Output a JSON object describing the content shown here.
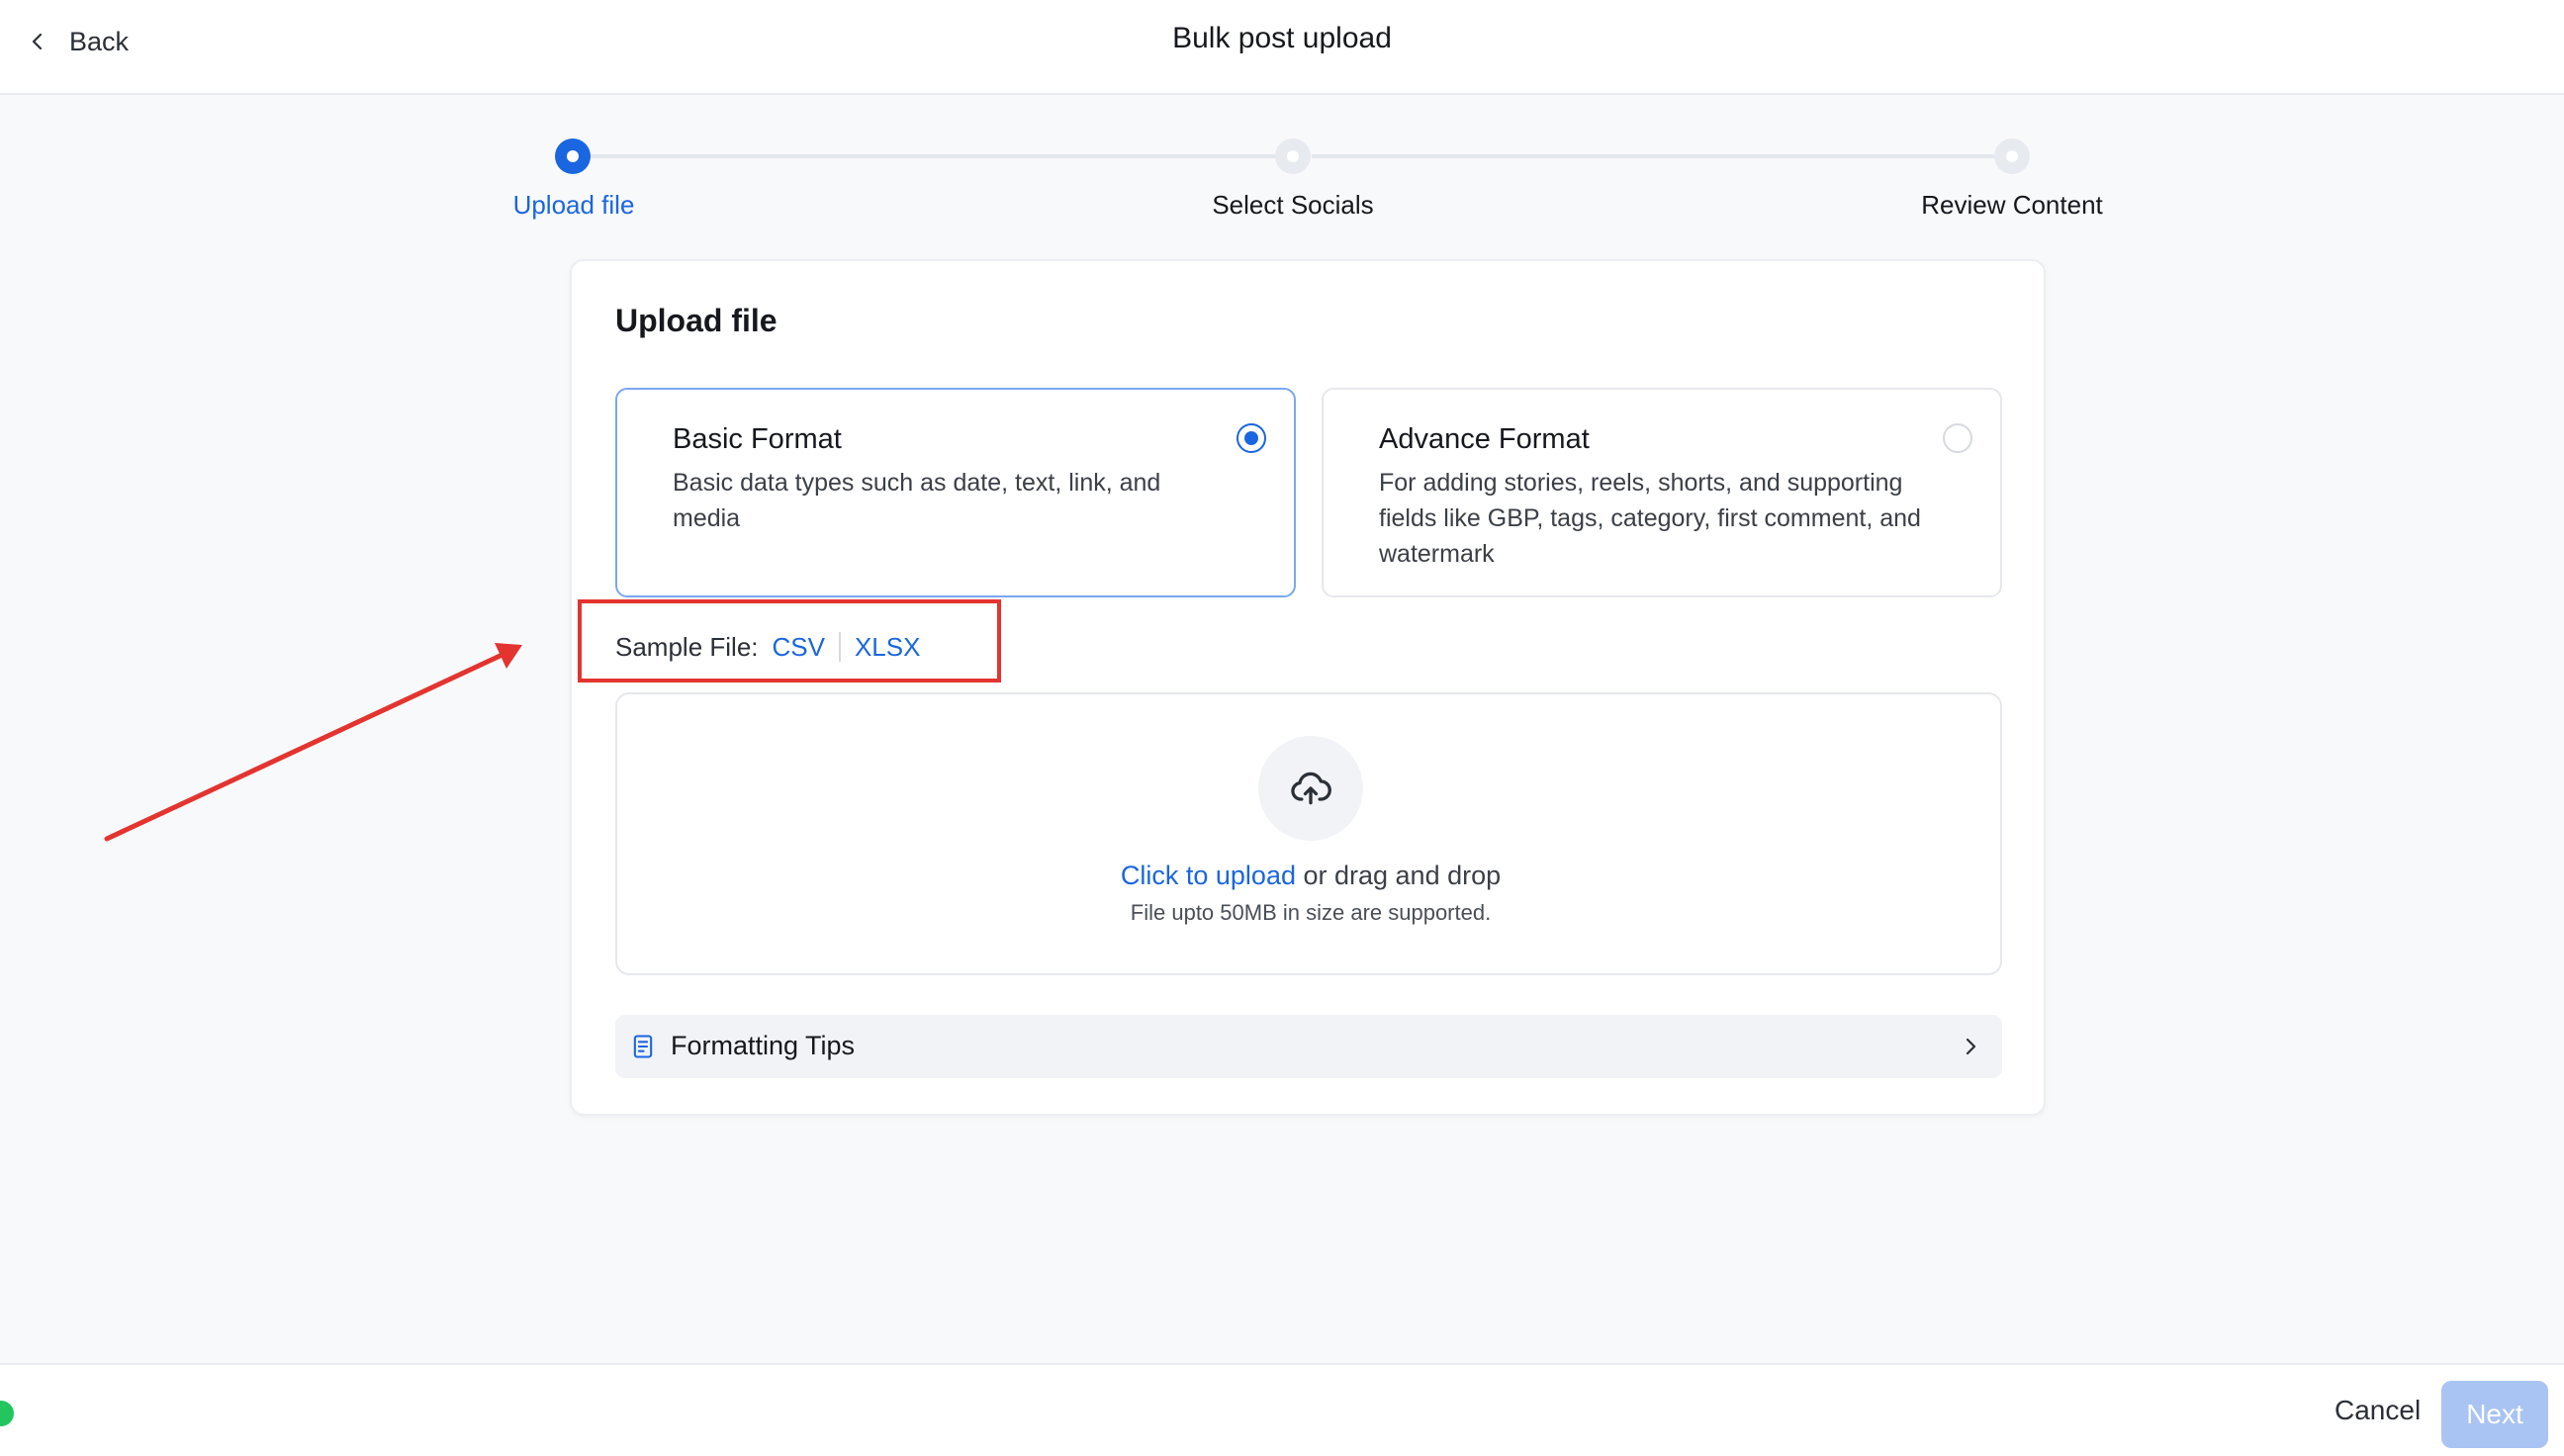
{
  "header": {
    "back_label": "Back",
    "title": "Bulk post upload"
  },
  "stepper": {
    "steps": [
      {
        "label": "Upload file",
        "state": "active"
      },
      {
        "label": "Select Socials",
        "state": "pending"
      },
      {
        "label": "Review Content",
        "state": "pending"
      }
    ]
  },
  "card": {
    "title": "Upload file",
    "formats": [
      {
        "name": "Basic Format",
        "description": "Basic data types such as date, text, link, and media",
        "selected": true
      },
      {
        "name": "Advance Format",
        "description": "For adding stories, reels, shorts, and supporting fields like GBP, tags, category, first comment, and watermark",
        "selected": false
      }
    ],
    "sample": {
      "label": "Sample File:",
      "csv": "CSV",
      "xlsx": "XLSX"
    },
    "dropzone": {
      "link_text": "Click to upload",
      "rest_text": " or drag and drop",
      "subtext": "File upto 50MB in size are supported."
    },
    "tips_label": "Formatting Tips"
  },
  "footer": {
    "cancel_label": "Cancel",
    "next_label": "Next"
  },
  "colors": {
    "accent": "#1a66e0",
    "annotation": "#e3342f",
    "next_disabled": "#a9c3f3"
  }
}
